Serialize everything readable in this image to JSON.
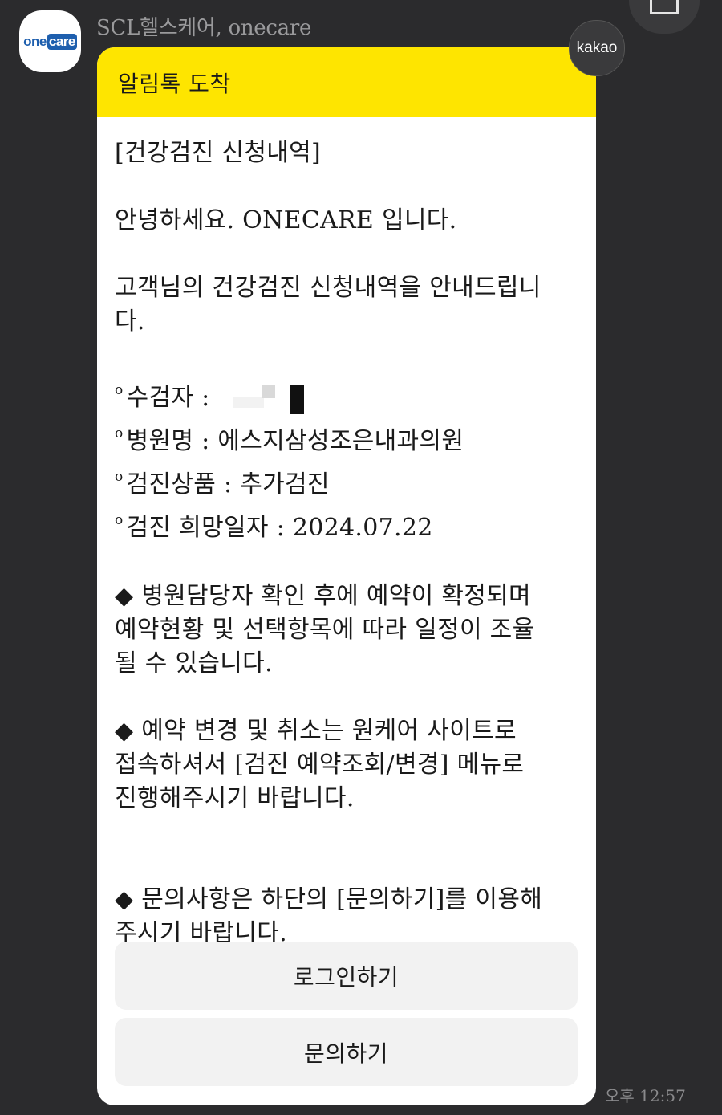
{
  "sender": {
    "name": "SCL헬스케어, onecare",
    "avatar_logo": {
      "one": "one",
      "care": "care"
    }
  },
  "badge": {
    "label": "kakao"
  },
  "message": {
    "header": "알림톡 도착",
    "title": "[건강검진 신청내역]",
    "greeting": "안녕하세요. ONECARE 입니다.",
    "intro_line1": "고객님의 건강검진 신청내역을 안내드립니",
    "intro_line2": "다.",
    "details": [
      {
        "marker": "o",
        "text": "수검자 :"
      },
      {
        "marker": "o",
        "text": "병원명 : 에스지삼성조은내과의원"
      },
      {
        "marker": "o",
        "text": "검진상품 : 추가검진"
      },
      {
        "marker": "o",
        "text": "검진 희망일자 : 2024.07.22"
      }
    ],
    "notice1": [
      "◆ 병원담당자 확인 후에 예약이 확정되며",
      "예약현황 및 선택항목에 따라 일정이 조율",
      "될 수 있습니다."
    ],
    "notice2": [
      "◆ 예약 변경 및 취소는 원케어 사이트로",
      "접속하셔서 [검진 예약조회/변경] 메뉴로",
      "진행해주시기 바랍니다."
    ],
    "notice3": [
      "◆ 문의사항은 하단의 [문의하기]를 이용해",
      " 주시기 바랍니다."
    ],
    "buttons": {
      "login": "로그인하기",
      "inquiry": "문의하기"
    }
  },
  "timestamp": "오후 12:57"
}
